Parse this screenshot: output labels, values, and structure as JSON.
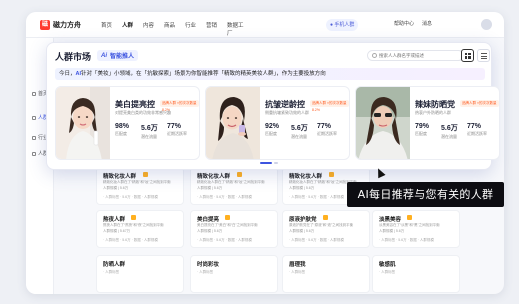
{
  "app": {
    "logo_text": "磁力方舟",
    "nav": [
      "首页",
      "人群",
      "内容",
      "商品",
      "行业",
      "营销",
      "数据工厂"
    ],
    "active_nav": "人群",
    "account": "● 手机人群",
    "nav_right": [
      "帮助中心",
      "消息"
    ]
  },
  "sidebar": {
    "items": [
      "首页",
      "人群",
      "行业",
      "人群"
    ]
  },
  "panel": {
    "title": "人群市场",
    "ai_logo": "Ai",
    "ai_label": "智能推人",
    "search_placeholder": "搜索人人群名字或描述",
    "banner_prefix": "今日，",
    "banner_ai": "AI",
    "banner_text": "针对「美妆」小领域，在「抗敏探索」场景为你智能推荐「精致的精英美妆人群」，作为主要投放方向",
    "cards": [
      {
        "name": "美白提亮控",
        "badge": "品牌人群 ×的次次数量 8.2%",
        "desc": "对提亮美白类的功效非常感兴趣",
        "stats": [
          {
            "v": "98%",
            "l": "匹配度"
          },
          {
            "v": "5.6万",
            "l": "潜在流量"
          },
          {
            "v": "77%",
            "l": "近期活跃率"
          }
        ]
      },
      {
        "name": "抗皱逆龄控",
        "badge": "品牌人群 ×的次次数量 8.2%",
        "desc": "侧重抗皱紧致功效的人群",
        "stats": [
          {
            "v": "92%",
            "l": "匹配度"
          },
          {
            "v": "5.6万",
            "l": "潜在流量"
          },
          {
            "v": "77%",
            "l": "近期活跃率"
          }
        ]
      },
      {
        "name": "辣妹防晒党",
        "badge": "品牌人群 ×的次次数量",
        "desc": "热衷户外防晒的人群",
        "stats": [
          {
            "v": "79%",
            "l": "匹配度"
          },
          {
            "v": "5.6万",
            "l": "潜在流量"
          },
          {
            "v": "77%",
            "l": "近期活跃率"
          }
        ]
      }
    ]
  },
  "grid": [
    {
      "title": "精致化妆人群",
      "desc": "精致化妆人群在了“精致”和“妆”之间找到平衡",
      "desc2": "人群规模 | 5.6万",
      "meta": "· 人群标签 · 5.6万  · 数据  · 人群规模"
    },
    {
      "title": "精致化妆人群",
      "desc": "精致化妆人群在了“精致”和“妆”之间找到平衡",
      "desc2": "人群规模 | 5.6万",
      "meta": "· 人群标签 · 5.6万  · 数据  · 人群规模"
    },
    {
      "title": "精致化妆人群",
      "desc": "精致化妆人群在了“精致”和“妆”之间找到平衡",
      "desc2": "人群规模 | 5.6万",
      "meta": "· 人群标签 · 5.6万  · 数据  · 人群规模"
    },
    {
      "title": "熬夜人群",
      "desc": "熬夜人群在了“熬夜”和“夜”之间找到平衡",
      "desc2": "人群规模 | 5.67万",
      "meta": "· 人群标签 · 5.6万  · 数据  · 人群规模"
    },
    {
      "title": "美白提亮",
      "desc": "美白提亮在了“美白”和“白”之间找到平衡",
      "desc2": "人群规模 | 5.6万",
      "meta": "· 人群标签 · 5.6万  · 数据  · 人群规模"
    },
    {
      "title": "原液护肤党",
      "desc": "原液护肤党在了“原液”和“液”之间找到平衡",
      "desc2": "人群规模 | 5.6万",
      "meta": "· 人群标签 · 5.6万  · 数据  · 人群规模"
    },
    {
      "title": "淡黑美容",
      "desc": "淡黑美容在了“淡黑”和“黑”之间找到平衡",
      "desc2": "人群规模 | 5.6万",
      "meta": "· 人群标签 · 5.6万  · 数据  · 人群规模"
    },
    {
      "title": "防晒人群",
      "desc": "",
      "desc2": "",
      "meta": "· 人群标签"
    },
    {
      "title": "时尚彩妆",
      "desc": "",
      "desc2": "",
      "meta": "· 人群标签"
    },
    {
      "title": "眉理我",
      "desc": "",
      "desc2": "",
      "meta": "· 人群标签"
    },
    {
      "title": "敏感肌",
      "desc": "",
      "desc2": "",
      "meta": "· 人群标签"
    }
  ],
  "tooltip": "AI每日推荐与您有关的人群",
  "colors": {
    "accent": "#3d54e0",
    "badge": "#ff5a1f",
    "tooltip_bg": "#0d0d12"
  }
}
